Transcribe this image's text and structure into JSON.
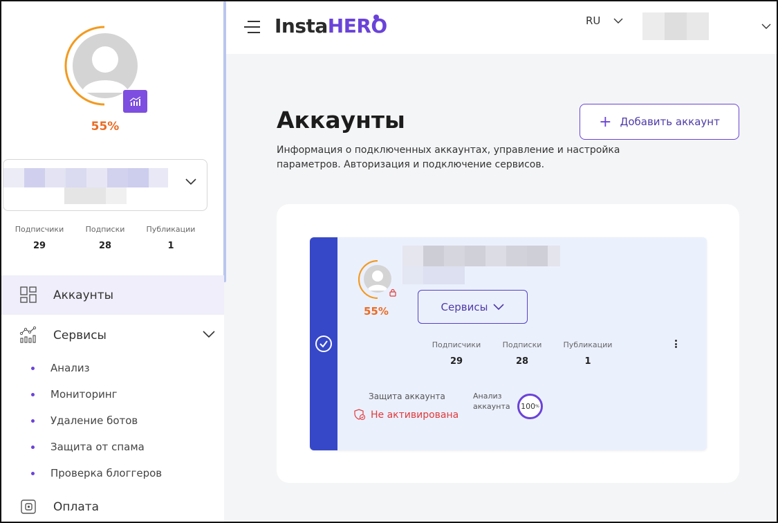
{
  "header": {
    "logo_left": "Insta",
    "logo_right": "HERO",
    "language": "RU"
  },
  "sidebar": {
    "progress_pct": "55%",
    "stats": [
      {
        "label": "Подписчики",
        "value": "29"
      },
      {
        "label": "Подписки",
        "value": "28"
      },
      {
        "label": "Публикации",
        "value": "1"
      }
    ],
    "nav": {
      "accounts": "Аккаунты",
      "services": "Сервисы",
      "payment": "Оплата"
    },
    "sub_items": [
      "Анализ",
      "Мониторинг",
      "Удаление ботов",
      "Защита от спама",
      "Проверка блоггеров"
    ]
  },
  "main": {
    "title": "Аккаунты",
    "description": "Информация о подключенных аккаунтах, управление и настройка параметров. Авторизация и подключение сервисов.",
    "add_button": "Добавить аккаунт"
  },
  "card": {
    "progress_pct": "55%",
    "services_button": "Сервисы",
    "stats": [
      {
        "label": "Подписчики",
        "value": "29"
      },
      {
        "label": "Подписки",
        "value": "28"
      },
      {
        "label": "Публикации",
        "value": "1"
      }
    ],
    "protection_label": "Защита аккаунта",
    "protection_status": "Не активирована",
    "analysis_label_1": "Анализ",
    "analysis_label_2": "аккаунта",
    "analysis_value": "100"
  },
  "colors": {
    "accent": "#6a43d8",
    "progress": "#ea6c24",
    "card_strip": "#3648c8",
    "danger": "#e03a3a"
  }
}
